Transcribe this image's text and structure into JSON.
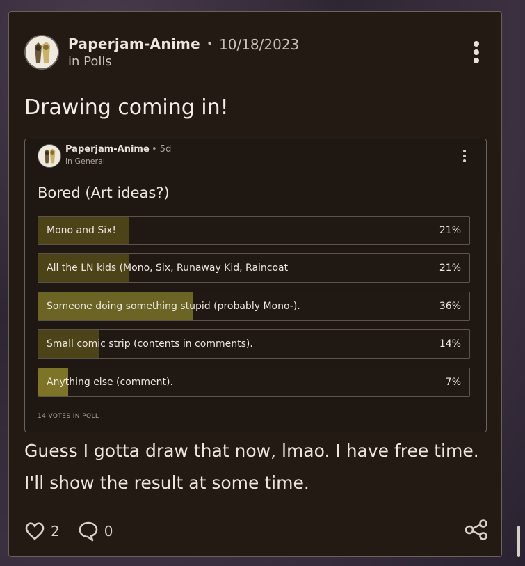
{
  "post": {
    "author": "Paperjam-Anime",
    "separator": "•",
    "date": "10/18/2023",
    "category_line": "in Polls",
    "title": "Drawing coming in!",
    "body_lines": [
      "Guess I gotta draw that now, lmao. I have free time.",
      "I'll show the result at some time."
    ]
  },
  "shared_poll": {
    "author": "Paperjam-Anime",
    "meta": "• 5d",
    "category_line": "in General",
    "title": "Bored (Art ideas?)",
    "options": [
      {
        "label": "Mono and Six!",
        "percent_text": "21%",
        "percent": 21
      },
      {
        "label": "All the LN kids (Mono, Six, Runaway Kid, Raincoat",
        "percent_text": "21%",
        "percent": 21
      },
      {
        "label": "Someone doing something stupid (probably Mono-).",
        "percent_text": "36%",
        "percent": 36
      },
      {
        "label": "Small comic strip (contents in comments).",
        "percent_text": "14%",
        "percent": 14
      },
      {
        "label": "Anything else (comment).",
        "percent_text": "7%",
        "percent": 7
      }
    ],
    "votes_text": "14 VOTES IN POLL"
  },
  "actions": {
    "like_count": "2",
    "comment_count": "0",
    "like_icon": "heart-icon",
    "comment_icon": "speech-bubble-icon",
    "share_icon": "share-icon"
  },
  "colors": {
    "card_bg": "#221a13",
    "poll_fill": "#4d4319",
    "poll_fill_leading": "#6b6424"
  }
}
